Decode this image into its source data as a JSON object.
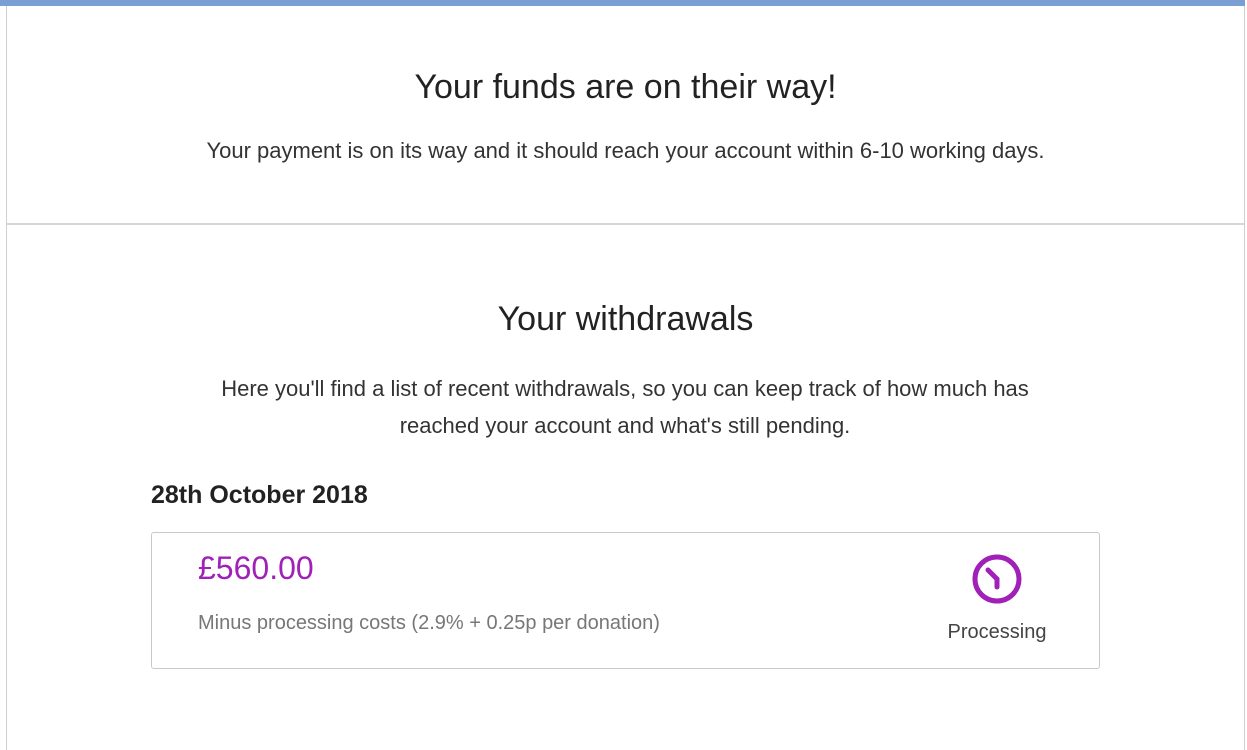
{
  "banner": {
    "title": "Your funds are on their way!",
    "subtitle": "Your payment is on its way and it should reach your account within 6-10 working days."
  },
  "withdrawals": {
    "title": "Your withdrawals",
    "description": "Here you'll find a list of recent withdrawals, so you can keep track of how much has reached your account and what's still pending.",
    "groups": [
      {
        "date": "28th October 2018",
        "items": [
          {
            "amount": "£560.00",
            "note": "Minus processing costs (2.9% + 0.25p per donation)",
            "status": "Processing",
            "status_icon": "clock-icon"
          }
        ]
      }
    ]
  },
  "colors": {
    "accent_bar": "#7a9fd4",
    "amount": "#a020b8",
    "status_icon": "#a020b8"
  }
}
